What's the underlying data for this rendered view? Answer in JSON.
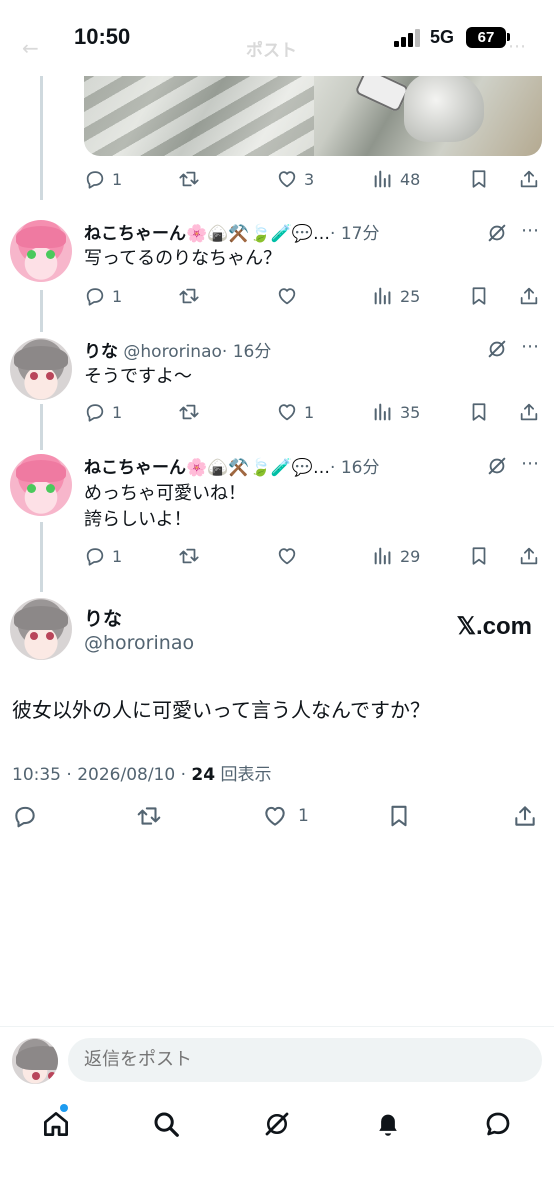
{
  "status_bar": {
    "time": "10:50",
    "network": "5G",
    "battery": "67",
    "faded_title": "ポスト"
  },
  "replies": [
    {
      "name": "ねこちゃーん",
      "emojis": "🌸🍙⚒️🍃🧪💬…",
      "time": "· 17分",
      "text": "写ってるのりなちゃん？",
      "replies": "1",
      "reposts": "",
      "likes": "",
      "views": "25"
    },
    {
      "name": "りな",
      "handle": "@hororinao",
      "time": "· 16分",
      "text": "そうですよ〜",
      "replies": "1",
      "reposts": "",
      "likes": "1",
      "views": "35"
    },
    {
      "name": "ねこちゃーん",
      "emojis": "🌸🍙⚒️🍃🧪💬…",
      "time": "· 16分",
      "text": "めっちゃ可愛いね！\n誇らしいよ！",
      "replies": "1",
      "reposts": "",
      "likes": "",
      "views": "29"
    }
  ],
  "first_post_stats": {
    "replies": "1",
    "reposts": "",
    "likes": "3",
    "views": "48"
  },
  "main_post": {
    "name": "りな",
    "handle": "@hororinao",
    "brand": "𝕏.com",
    "text": "彼女以外の人に可愛いって言う人なんですか？",
    "timestamp": "10:35 · 2026/08/10 · ",
    "views_count": "24",
    "views_label": " 回表示",
    "likes": "1"
  },
  "reply_bar": {
    "placeholder": "返信をポスト"
  },
  "colors": {
    "accent": "#1d9bf0",
    "muted": "#536471",
    "text": "#0f1419",
    "line": "#cfd9de"
  },
  "icons": [
    "reply-icon",
    "repost-icon",
    "like-icon",
    "views-icon",
    "bookmark-icon",
    "share-icon",
    "grok-icon",
    "home-icon",
    "search-icon",
    "notifications-icon",
    "messages-icon"
  ]
}
